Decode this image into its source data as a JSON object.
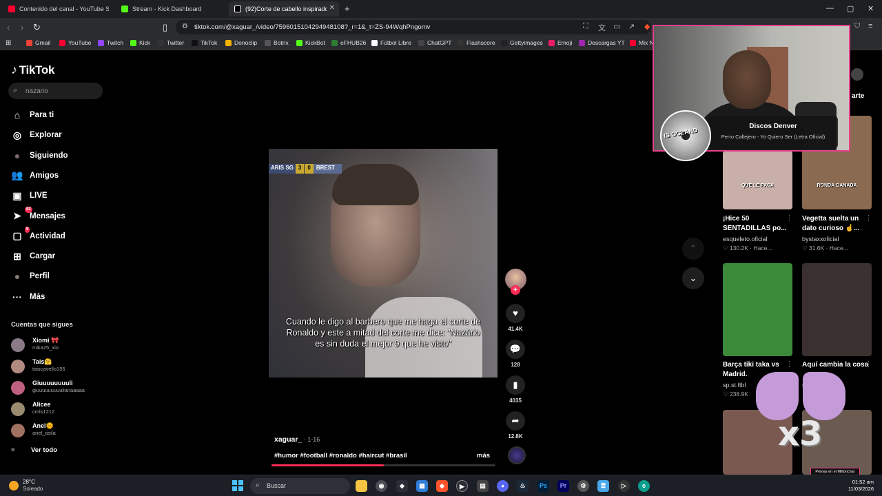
{
  "tabs": [
    {
      "label": "Contenido del canal - YouTube Studio",
      "color": "#ff0033"
    },
    {
      "label": "Stream - Kick Dashboard",
      "color": "#53fc18"
    },
    {
      "label": "(92)Corte de cabello inspirado",
      "color": "#ffffff",
      "active": true
    }
  ],
  "url": "tiktok.com/@xaguar_/video/7596015104294948108?_r=1&_t=ZS-94WqhPngomv",
  "bookmarks": [
    {
      "label": "Gmail",
      "color": "#ea4335"
    },
    {
      "label": "YouTube",
      "color": "#ff0033"
    },
    {
      "label": "Twitch",
      "color": "#9146ff"
    },
    {
      "label": "Kick",
      "color": "#53fc18"
    },
    {
      "label": "Twitter",
      "color": "#333333"
    },
    {
      "label": "TikTok",
      "color": "#111111"
    },
    {
      "label": "Donoclip",
      "color": "#f5b400"
    },
    {
      "label": "Botrix",
      "color": "#555555"
    },
    {
      "label": "KickBot",
      "color": "#53fc18"
    },
    {
      "label": "eFHUB26",
      "color": "#2e7d32"
    },
    {
      "label": "Fútbol Libre",
      "color": "#ffffff"
    },
    {
      "label": "ChatGPT",
      "color": "#444444"
    },
    {
      "label": "Flashscore",
      "color": "#333333"
    },
    {
      "label": "Gettyimages",
      "color": "#222222"
    },
    {
      "label": "Emoji",
      "color": "#e91e63"
    },
    {
      "label": "Descargas YT",
      "color": "#9c27b0"
    },
    {
      "label": "Mix N",
      "color": "#ff0033"
    }
  ],
  "tiktok": {
    "logo": "TikTok",
    "search_placeholder": "nazario",
    "nav": [
      {
        "label": "Para ti",
        "icon": "home-icon",
        "glyph": "⌂"
      },
      {
        "label": "Explorar",
        "icon": "compass-icon",
        "glyph": "◎"
      },
      {
        "label": "Siguiendo",
        "icon": "following-avatar-icon",
        "glyph": "●"
      },
      {
        "label": "Amigos",
        "icon": "friends-icon",
        "glyph": "👥"
      },
      {
        "label": "LIVE",
        "icon": "live-icon",
        "glyph": "▣"
      },
      {
        "label": "Mensajes",
        "icon": "messages-icon",
        "glyph": "➤",
        "badge": "92"
      },
      {
        "label": "Actividad",
        "icon": "activity-icon",
        "glyph": "▢",
        "badge": "9"
      },
      {
        "label": "Cargar",
        "icon": "upload-icon",
        "glyph": "⊞"
      },
      {
        "label": "Perfil",
        "icon": "profile-avatar-icon",
        "glyph": "●"
      },
      {
        "label": "Más",
        "icon": "more-icon",
        "glyph": "···"
      }
    ],
    "following_header": "Cuentas que sigues",
    "following": [
      {
        "name": "Xiomi 🎀",
        "handle": "mika25_xio",
        "color": "#8a7a88"
      },
      {
        "name": "Tais🤗",
        "handle": "taiscavello155",
        "color": "#b08a80"
      },
      {
        "name": "Giuuuuuuuuli",
        "handle": "giuuuuuuuuulianaaaaa",
        "color": "#c06080"
      },
      {
        "name": "Alicee",
        "handle": "cmls1212",
        "color": "#9a8a70"
      },
      {
        "name": "Anel🌞",
        "handle": "anel_asila",
        "color": "#a07060"
      }
    ],
    "see_all": "Ver todo"
  },
  "video": {
    "scorebug": {
      "team1": "ARIS SG",
      "score1": "3",
      "score2": "0",
      "team2": "BREST"
    },
    "caption": "Cuando le digo al barbero que me haga el corte de Ronaldo y este a mitad del corte me dice: \"Nazário es sin duda el mejor 9 que he visto\"",
    "author": "xaguar_",
    "posted": " · 1-16",
    "tags": "#humor #football #ronaldo #haircut #brasil",
    "more": "más",
    "progress": 0.5,
    "actions": {
      "likes": "41.4K",
      "comments": "128",
      "saves": "4035",
      "shares": "12.8K"
    }
  },
  "sidebar_share": "arte",
  "recommended": [
    {
      "title": "¡Hice 50 SENTADILLAS po...",
      "user": "esqueleto.oficial",
      "stats": "♡ 130.2K · Hace...",
      "thumb": "#c8b0a8",
      "overlay": "QUE LE PASA"
    },
    {
      "title": "Vegetta suelta un dato curioso ☝...",
      "user": "bystaxxoficial",
      "stats": "♡ 31.6K · Hace...",
      "thumb": "#8a6a50",
      "overlay": "RONDA GANADA"
    },
    {
      "title": "Barça tiki taka vs Madrid.",
      "user": "sp.st.ftbl",
      "stats": "♡ 238.9K",
      "thumb": "#3a8a3a"
    },
    {
      "title": "Aquí cambia la cosa",
      "user": "s",
      "stats": "",
      "thumb": "#3a3030"
    },
    {
      "title": "",
      "user": "",
      "stats": "",
      "thumb": "#7a5a50"
    },
    {
      "title": "",
      "user": "",
      "stats": "",
      "thumb": "#6a5a50"
    }
  ],
  "now_playing": {
    "artist": "Discos Denver",
    "song": "Perro Callejero - Yo Quiero Ser (Letra Oficial)",
    "disc_text": "IS OCLAND"
  },
  "emote": {
    "text": "x3"
  },
  "clip_badge": "Pemas en el Millonchar",
  "taskbar": {
    "temp": "28°C",
    "condition": "Soleado",
    "search": "Buscar",
    "time": "01:52 am",
    "date": "11/03/2026"
  }
}
